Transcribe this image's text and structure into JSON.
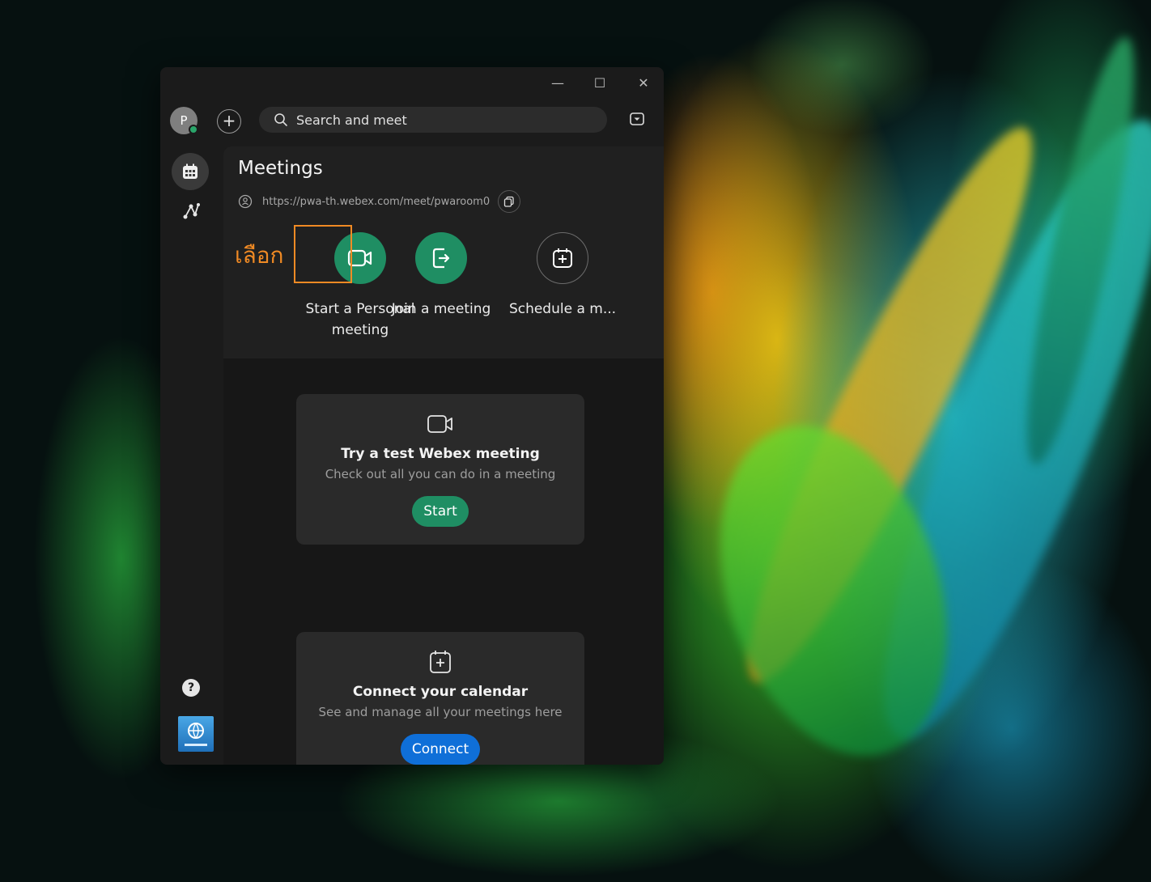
{
  "window": {
    "controls": {
      "minimize": "—",
      "maximize": "☐",
      "close": "✕"
    }
  },
  "topbar": {
    "avatar_initial": "P",
    "add_symbol": "+",
    "search_placeholder": "Search and meet"
  },
  "meetings": {
    "title": "Meetings",
    "personal_room_link": "https://pwa-th.webex.com/meet/pwaroom0",
    "actions": [
      {
        "label": "Start a Personal meeting",
        "icon": "video-camera-icon"
      },
      {
        "label": "Join a meeting",
        "icon": "join-door-icon"
      },
      {
        "label": "Schedule a m...",
        "icon": "calendar-add-icon"
      }
    ],
    "annotation": "เลือก"
  },
  "cards": {
    "test_meeting": {
      "title": "Try a test Webex meeting",
      "description": "Check out all you can do in a meeting",
      "button": "Start"
    },
    "calendar": {
      "title": "Connect your calendar",
      "description": "See and manage all your meetings here",
      "button": "Connect"
    }
  },
  "leftrail": {
    "help_symbol": "?"
  },
  "colors": {
    "accent_green": "#1f8e63",
    "accent_blue": "#0f6fd8",
    "annotation_orange": "#f08a24",
    "window_bg": "#1b1b1b"
  }
}
